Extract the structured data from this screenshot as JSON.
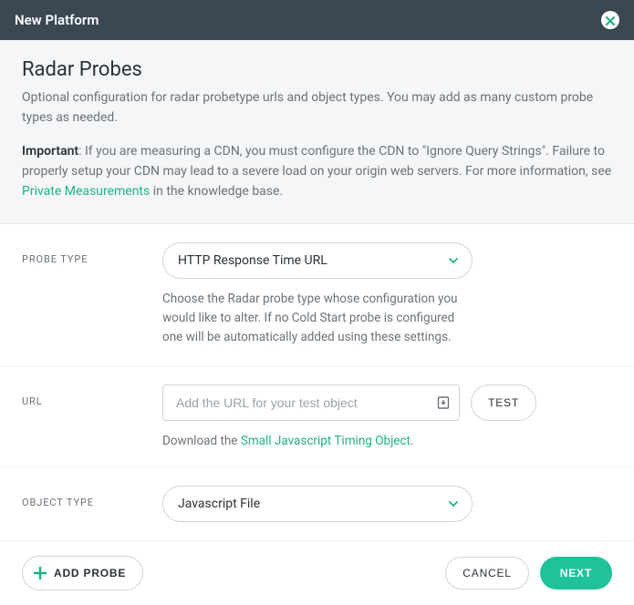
{
  "header": {
    "title": "New Platform"
  },
  "intro": {
    "heading": "Radar Probes",
    "desc": "Optional configuration for radar probetype urls and object types. You may add as many custom probe types as needed.",
    "important_label": "Important",
    "important_text_a": ": If you are measuring a CDN, you must configure the CDN to \"Ignore Query Strings\". Failure to properly setup your CDN may lead to a severe load on your origin web servers. For more information, see ",
    "important_link": "Private Measurements",
    "important_text_b": " in the knowledge base."
  },
  "probe_type": {
    "label": "PROBE TYPE",
    "value": "HTTP Response Time URL",
    "helper": "Choose the Radar probe type whose configuration you would like to alter. If no Cold Start probe is configured one will be automatically added using these settings."
  },
  "url": {
    "label": "URL",
    "placeholder": "Add the URL for your test object",
    "test_label": "TEST",
    "download_pre": "Download the ",
    "download_link": "Small Javascript Timing Object",
    "download_post": "."
  },
  "object_type": {
    "label": "OBJECT TYPE",
    "value": "Javascript File"
  },
  "footer": {
    "add_probe": "ADD PROBE",
    "cancel": "CANCEL",
    "next": "NEXT"
  }
}
